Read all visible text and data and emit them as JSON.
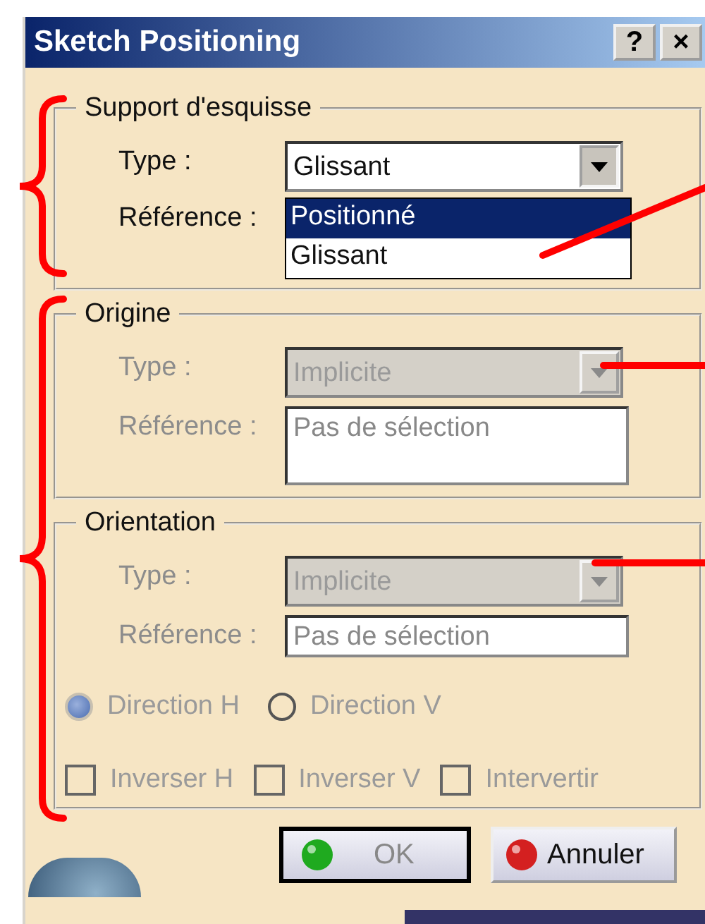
{
  "window": {
    "title": "Sketch Positioning",
    "help_button": "?",
    "close_button": "×"
  },
  "support": {
    "legend": "Support d'esquisse",
    "type_label": "Type :",
    "type_value": "Glissant",
    "expanded": true,
    "options": [
      {
        "label": "Positionné",
        "selected": true
      },
      {
        "label": "Glissant",
        "selected": false
      }
    ],
    "reference_label": "Référence :"
  },
  "origin": {
    "legend": "Origine",
    "disabled": true,
    "type_label": "Type :",
    "type_value": "Implicite",
    "reference_label": "Référence :",
    "reference_value": "Pas de sélection"
  },
  "orientation": {
    "legend": "Orientation",
    "disabled": true,
    "type_label": "Type :",
    "type_value": "Implicite",
    "reference_label": "Référence :",
    "reference_value": "Pas de sélection",
    "radios": [
      {
        "label": "Direction H",
        "selected": true
      },
      {
        "label": "Direction V",
        "selected": false
      }
    ],
    "checkboxes": [
      {
        "label": "Inverser H",
        "checked": false
      },
      {
        "label": "Inverser V",
        "checked": false
      },
      {
        "label": "Intervertir",
        "checked": false
      }
    ]
  },
  "buttons": [
    {
      "label": "OK",
      "disabled": true,
      "kind": "ok"
    },
    {
      "label": "Annuler",
      "disabled": false,
      "kind": "cancel"
    }
  ]
}
